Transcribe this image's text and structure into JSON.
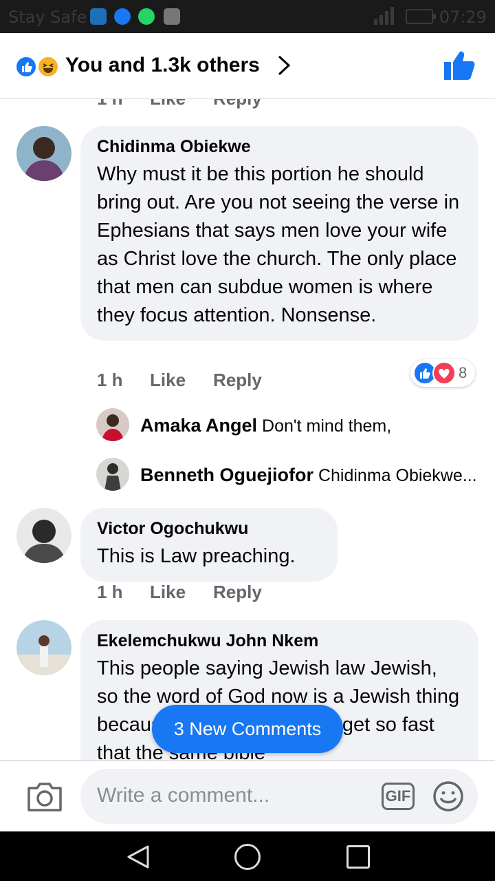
{
  "status_bar": {
    "carrier": "Stay Safe",
    "time": "07:29"
  },
  "header": {
    "summary": "You and 1.3k others"
  },
  "cut_row": {
    "time": "1 h",
    "like": "Like",
    "reply": "Reply"
  },
  "comments": [
    {
      "author": "Chidinma Obiekwe",
      "text": "Why must it be this portion he should bring out. Are you not seeing the verse in Ephesians that says men love your wife as Christ love the church. The only place that men can subdue women is where they focus attention. Nonsense.",
      "time": "1 h",
      "like": "Like",
      "reply": "Reply",
      "reaction_count": "8",
      "replies": [
        {
          "author": "Amaka Angel",
          "text": "Don't mind them,"
        },
        {
          "author": "Benneth Oguejiofor",
          "text": "Chidinma Obiekwe..."
        }
      ]
    },
    {
      "author": "Victor Ogochukwu",
      "text": "This is Law preaching.",
      "time": "1 h",
      "like": "Like",
      "reply": "Reply"
    },
    {
      "author": "Ekelemchukwu John Nkem",
      "text": "This people saying Jewish law Jewish, so the word of God now is a Jewish thing because it's a woman! U forget so fast that the same bible"
    }
  ],
  "new_comments_label": "3 New Comments",
  "composer": {
    "placeholder": "Write a comment...",
    "gif_label": "GIF"
  },
  "colors": {
    "accent": "#1877f2",
    "bubble": "#f0f2f5",
    "muted": "#65676b"
  }
}
